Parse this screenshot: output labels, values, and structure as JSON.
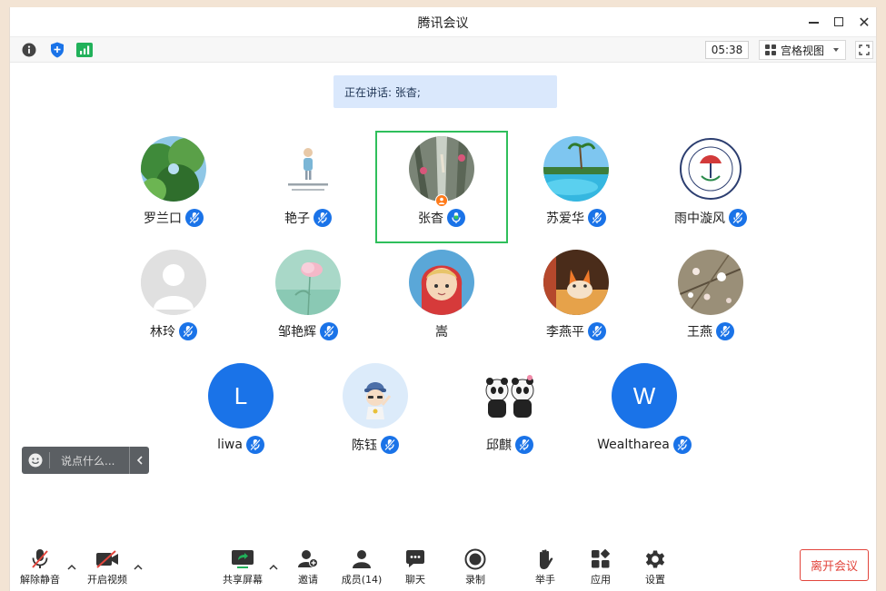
{
  "window": {
    "title": "腾讯会议"
  },
  "toolbar": {
    "timer": "05:38",
    "view_label": "宫格视图"
  },
  "speaking": {
    "text": "正在讲话: 张杳;"
  },
  "participants": [
    {
      "name": "罗兰口"
    },
    {
      "name": "艳子"
    },
    {
      "name": "张杳"
    },
    {
      "name": "苏爱华"
    },
    {
      "name": "雨中漩风"
    },
    {
      "name": "林玲"
    },
    {
      "name": "邹艳辉"
    },
    {
      "name": "嵩"
    },
    {
      "name": "李燕平"
    },
    {
      "name": "王燕"
    },
    {
      "name": "liwa",
      "initial": "L"
    },
    {
      "name": "陈钰"
    },
    {
      "name": "邱麒"
    },
    {
      "name": "Wealtharea",
      "initial": "W"
    }
  ],
  "chat": {
    "placeholder": "说点什么..."
  },
  "bottom": {
    "unmute": "解除静音",
    "start_video": "开启视频",
    "share_screen": "共享屏幕",
    "invite": "邀请",
    "members": "成员(14)",
    "chat": "聊天",
    "record": "录制",
    "raise_hand": "举手",
    "apps": "应用",
    "settings": "设置",
    "leave": "离开会议"
  },
  "colors": {
    "accent": "#1a73e8",
    "active_border": "#2fbf5b",
    "leave": "#e2453c",
    "host": "#ff7a1a"
  }
}
